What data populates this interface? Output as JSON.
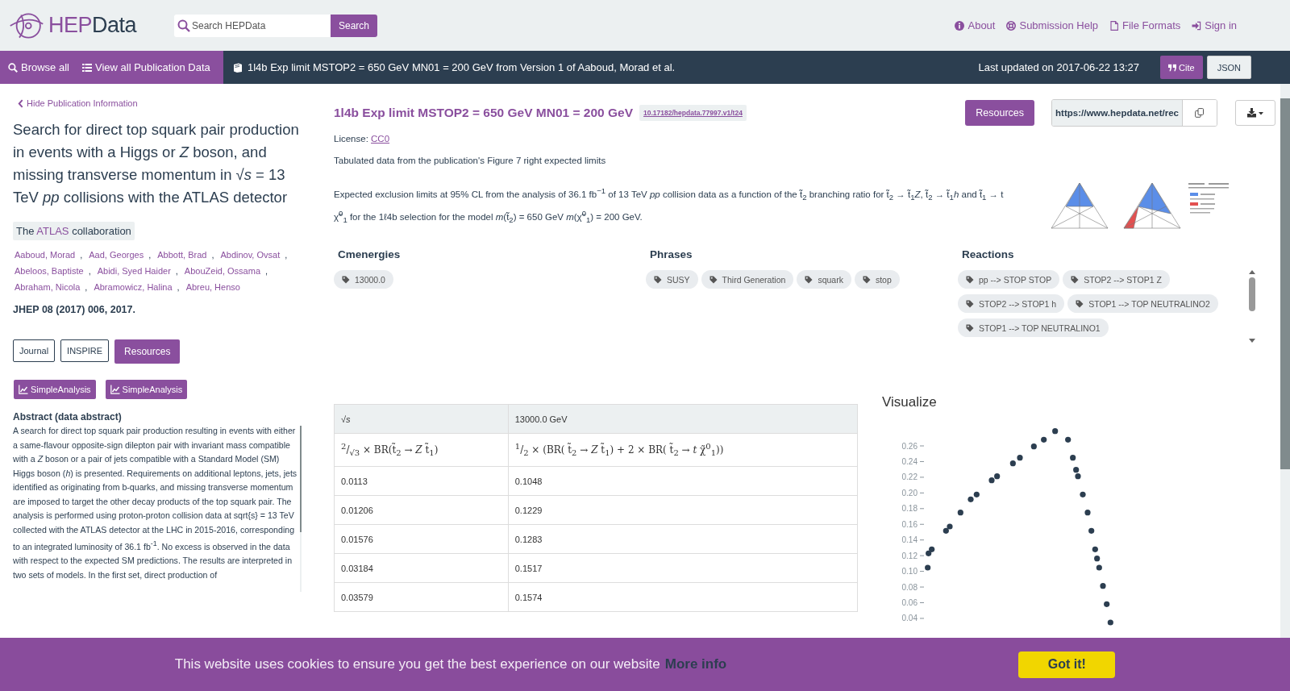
{
  "header": {
    "logo": {
      "part1": "HEP",
      "part2": "Data"
    },
    "search": {
      "placeholder": "Search HEPData",
      "button": "Search"
    },
    "links": [
      "About",
      "Submission Help",
      "File Formats",
      "Sign in"
    ]
  },
  "nav": {
    "browse": "Browse all",
    "view_all": "View all Publication Data",
    "record": "1l4b Exp limit MSTOP2 = 650 GeV MN01 = 200 GeV from Version 1 of Aaboud, Morad et al.",
    "updated": "Last updated on 2017-06-22 13:27",
    "cite": "Cite",
    "json": "JSON"
  },
  "publication": {
    "hide_link": "Hide Publication Information",
    "title": "Search for direct top squark pair production in events with a Higgs or *Z* boson, and missing transverse momentum in √*s* = 13 TeV *pp* collisions with the ATLAS detector",
    "collaboration": {
      "before": "The",
      "name": "ATLAS",
      "after": "collaboration"
    },
    "author_separator": ",",
    "authors": [
      "Aaboud, Morad",
      "Aad, Georges",
      "Abbott, Brad",
      "Abdinov, Ovsat",
      "Abeloos, Baptiste",
      "Abidi, Syed Haider",
      "AbouZeid, Ossama",
      "Abraham, Nicola",
      "Abramowicz, Halina",
      "Abreu, Henso"
    ],
    "journal": "JHEP 08 (2017) 006, 2017.",
    "buttons": [
      {
        "label": "Journal",
        "kind": "outline"
      },
      {
        "label": "INSPIRE",
        "kind": "outline"
      },
      {
        "label": "Resources",
        "kind": "filled"
      }
    ],
    "analysis_buttons": [
      "SimpleAnalysis",
      "SimpleAnalysis"
    ],
    "abstract_heading": "Abstract (data abstract)",
    "abstract": "A search for direct top squark pair production resulting in events with either a same-flavour opposite-sign dilepton pair with invariant mass compatible with a *Z* boson or a pair of jets compatible with a Standard Model (SM) Higgs boson (*h*) is presented. Requirements on additional leptons, jets, jets identified as originating from b-quarks, and missing transverse momentum are imposed to target the other decay products of the top squark pair. The analysis is performed using proton-proton collision data at sqrt{s} = 13 TeV collected with the ATLAS detector at the LHC in 2015-2016, corresponding to an integrated luminosity of 36.1 fb$^{-1}$. No excess is observed in the data with respect to the expected SM predictions. The results are interpreted in two sets of models. In the first set, direct production of"
  },
  "table_info": {
    "title": "1l4b Exp limit MSTOP2 = 650 GeV MN01 = 200 GeV",
    "doi": "10.17182/hepdata.77997.v1/t24",
    "resources": "Resources",
    "url": "https://www.hepdata.net/rec",
    "license_label": "License:",
    "license": "CC0",
    "location": "Tabulated data from the publication's Figure 7 right expected limits",
    "description": "Expected exclusion limits at 95% CL from the analysis of 36.1 fb$^{−1}$ of 13 TeV *pp* collision data as a function of the t̃$_{2}$ branching ratio for t̃$_{2}$ → t̃$_{1}$*Z*, t̃$_{2}$ → t̃$_{1}$*h* and t̃$_{1}$ → t χ̃$^{0}$$_{1}$ for the 1ℓ4b selection for the model *m*(t̃$_{2}$) = 650 GeV *m*(χ̃$^{0}$$_{1}$) = 200 GeV."
  },
  "keywords": [
    {
      "heading": "Cmenergies",
      "tags": [
        "13000.0"
      ]
    },
    {
      "heading": "Phrases",
      "tags": [
        "SUSY",
        "Third Generation",
        "squark",
        "stop"
      ]
    },
    {
      "heading": "Reactions",
      "tags": [
        "pp --> STOP STOP",
        "STOP2 --> STOP1 Z",
        "STOP2 --> STOP1 h",
        "STOP1 --> TOP NEUTRALINO2",
        "STOP1 --> TOP NEUTRALINO1"
      ]
    }
  ],
  "table": {
    "header": [
      "√*s*",
      "13000.0 GeV"
    ],
    "columns": [
      "$^{2}$/$_{√3}$ × BR(t̃$_{2}$ → *Z* t̃$_{1}$)",
      "$^{1}$/$_{2}$ × (BR( t̃$_{2}$ → *Z* t̃$_{1}$) + 2 × BR( t̃$_{2}$ → *t* χ̃$^{0}$$_{1}$))"
    ],
    "rows": [
      [
        "0.0113",
        "0.1048"
      ],
      [
        "0.01206",
        "0.1229"
      ],
      [
        "0.01576",
        "0.1283"
      ],
      [
        "0.03184",
        "0.1517"
      ],
      [
        "0.03579",
        "0.1574"
      ]
    ]
  },
  "visualize": {
    "title": "Visualize",
    "y_axis_labels": [
      "0.26",
      "0.24",
      "0.22",
      "0.20",
      "0.18",
      "0.16",
      "0.14",
      "0.12",
      "0.10",
      "0.08",
      "0.06",
      "0.04"
    ]
  },
  "cookie": {
    "message": "This website uses cookies to ensure you get the best experience on our website",
    "more": "More info",
    "button": "Got it!"
  }
}
